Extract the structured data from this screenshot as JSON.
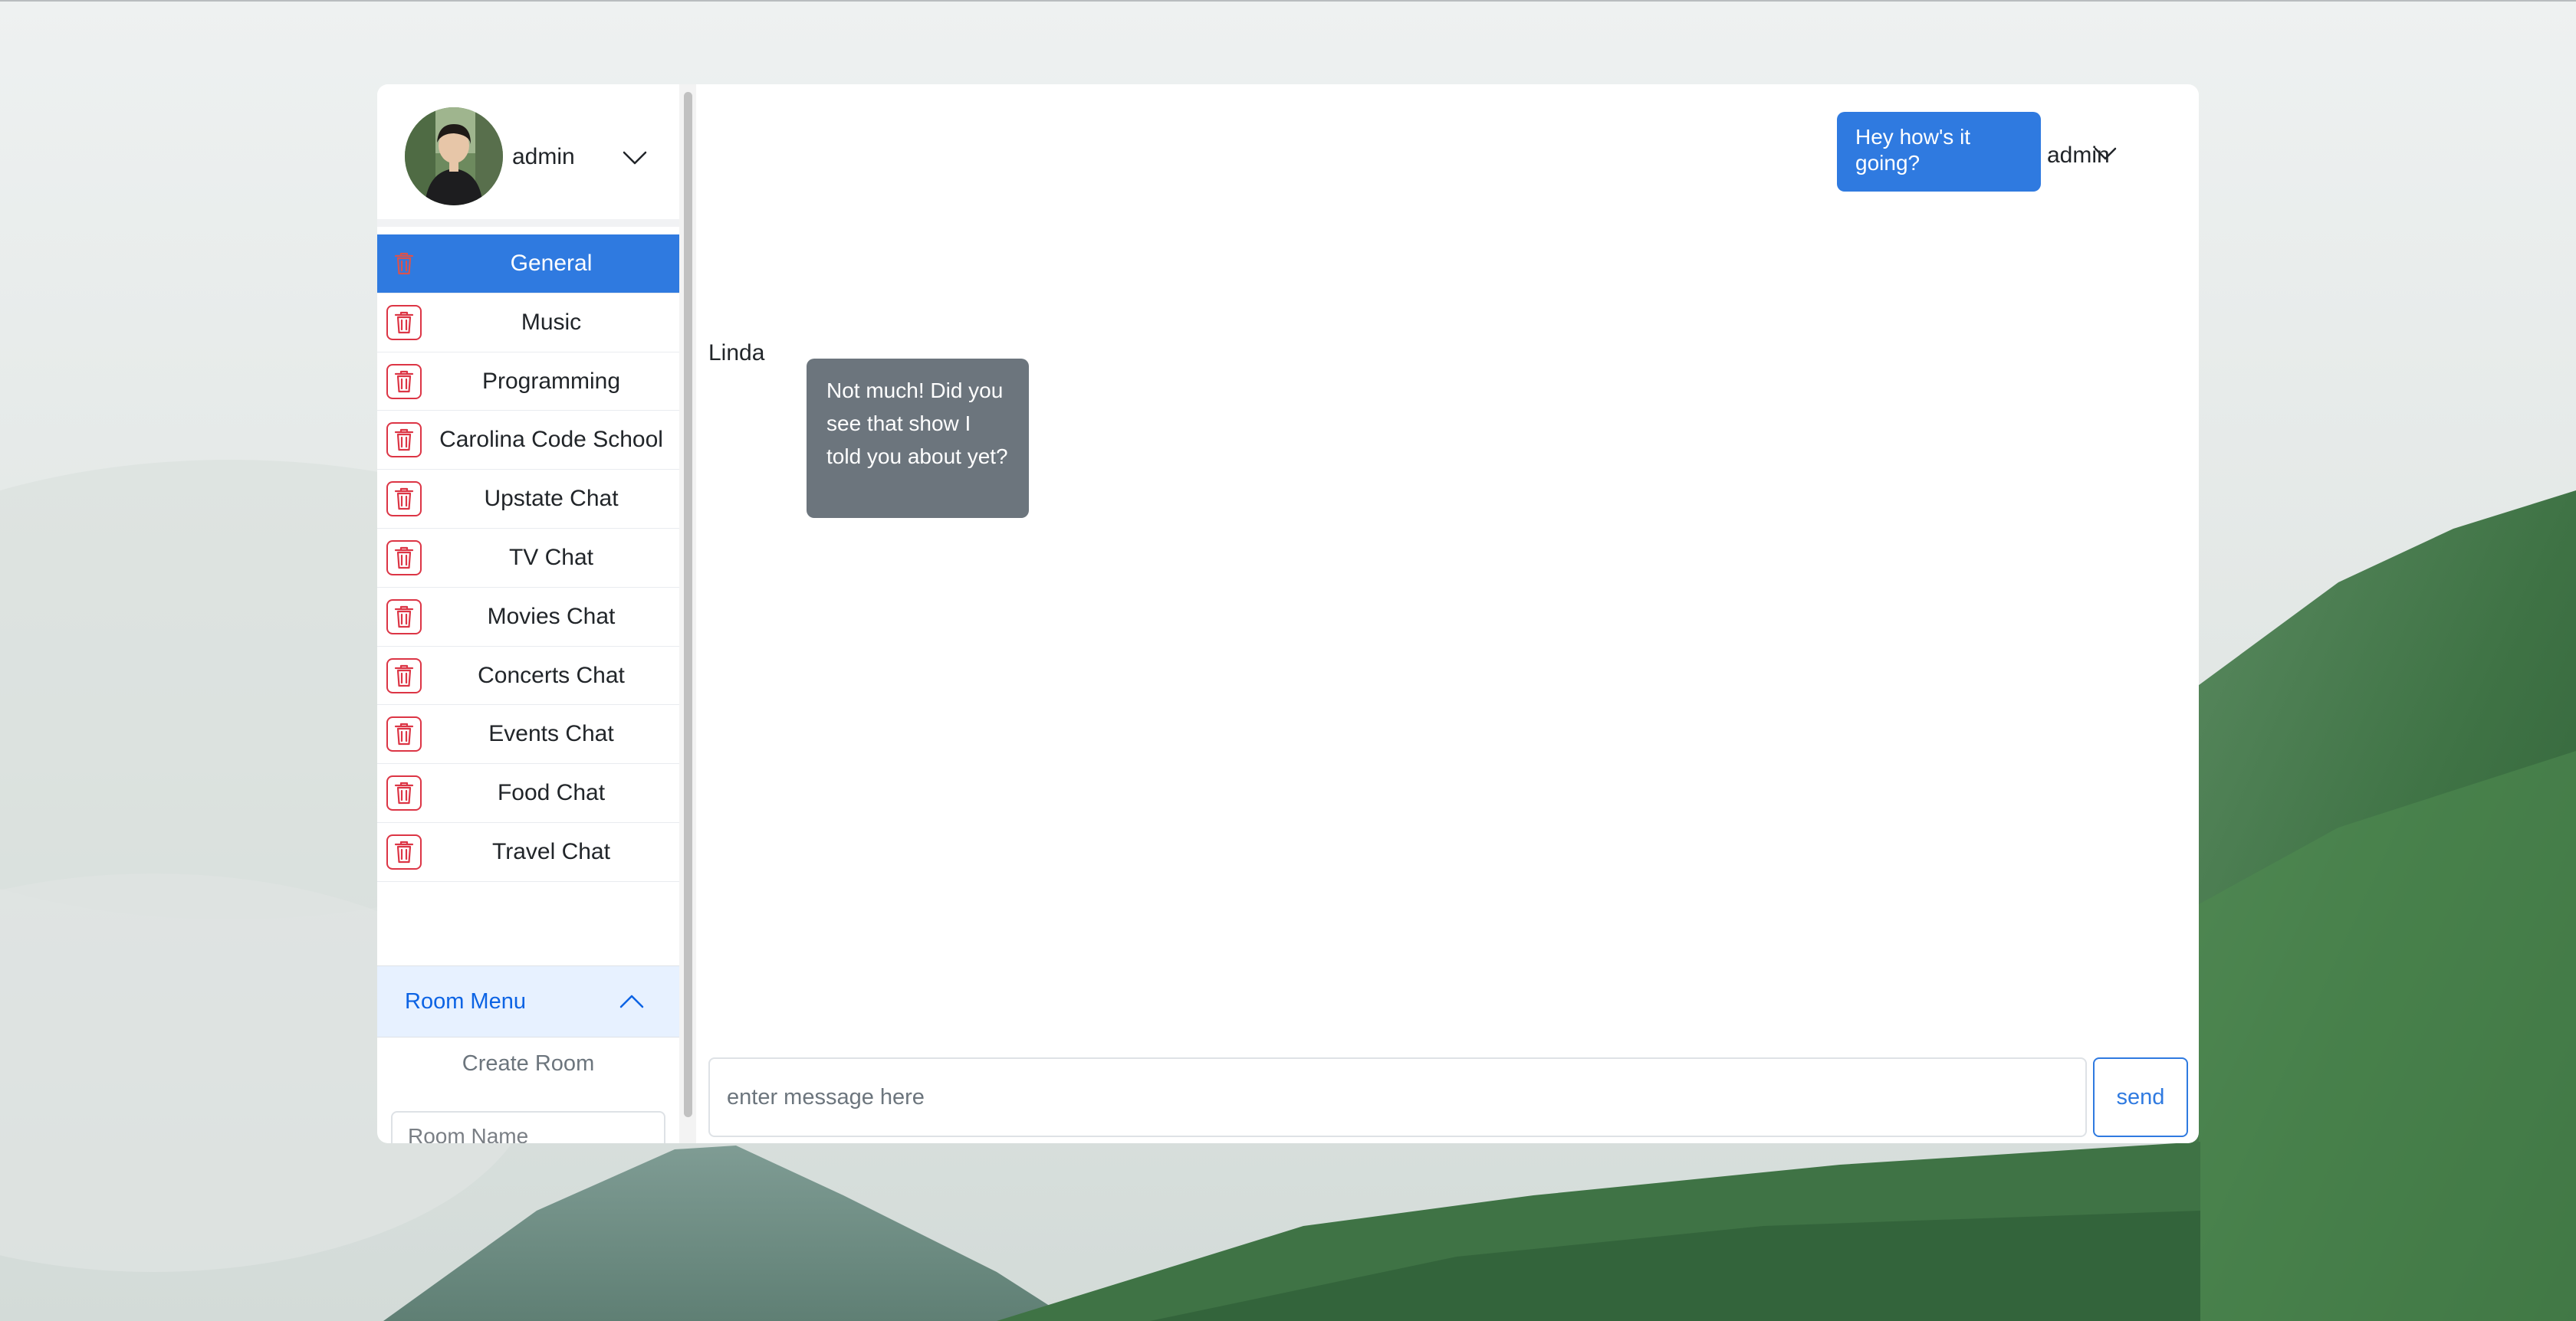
{
  "colors": {
    "accent": "#2f7ae0",
    "danger": "#dc3545",
    "incoming_bubble": "#6c757d",
    "accordion_bg": "#e7f1ff"
  },
  "user": {
    "name": "admin",
    "avatar_icon": "user-avatar-photo",
    "menu_icon": "chevron-down-icon"
  },
  "rooms": [
    {
      "label": "General",
      "active": true
    },
    {
      "label": "Music",
      "active": false
    },
    {
      "label": "Programming",
      "active": false
    },
    {
      "label": "Carolina Code School",
      "active": false
    },
    {
      "label": "Upstate Chat",
      "active": false
    },
    {
      "label": "TV Chat",
      "active": false
    },
    {
      "label": "Movies Chat",
      "active": false
    },
    {
      "label": "Concerts Chat",
      "active": false
    },
    {
      "label": "Events Chat",
      "active": false
    },
    {
      "label": "Food Chat",
      "active": false
    },
    {
      "label": "Travel Chat",
      "active": false
    }
  ],
  "room_menu": {
    "label": "Room Menu",
    "expanded": true,
    "create_title": "Create Room",
    "room_name_placeholder": "Room Name",
    "add_label": "+"
  },
  "messages": [
    {
      "author": "admin",
      "direction": "outgoing",
      "text": "Hey how's it going?"
    },
    {
      "author": "Linda",
      "direction": "incoming",
      "text": "Not much! Did you see that show I told you about yet?"
    }
  ],
  "composer": {
    "placeholder": "enter message here",
    "send_label": "send"
  }
}
